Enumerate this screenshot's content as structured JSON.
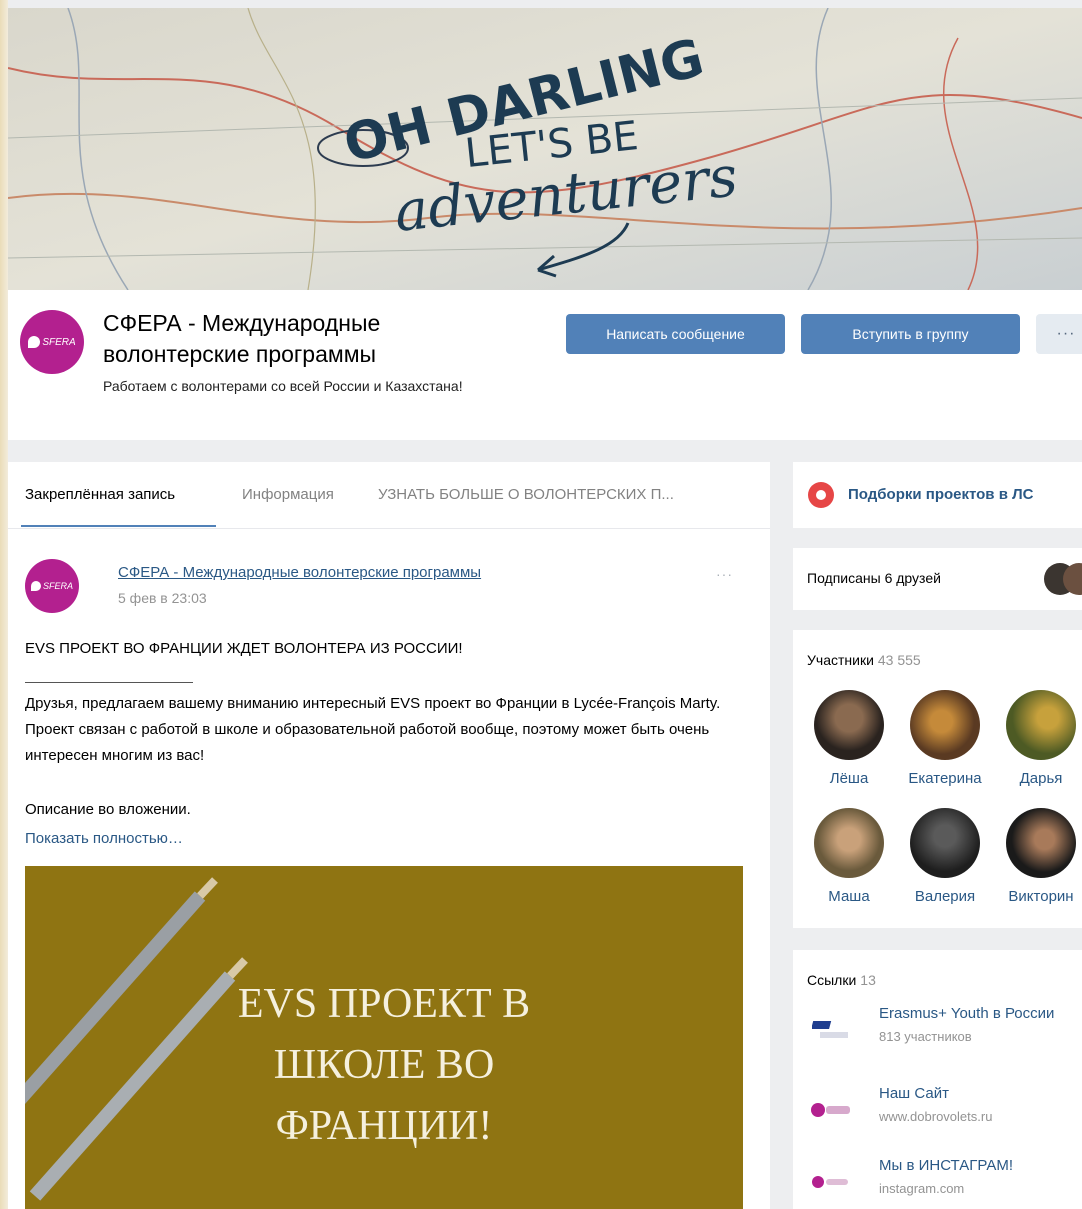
{
  "cover": {
    "line1": "OH DARLING",
    "line2": "LET'S BE",
    "line3": "adventurers"
  },
  "group": {
    "name": "СФЕРА - Международные волонтерские программы",
    "status": "Работаем с волонтерами со всей России и Казахстана!",
    "avatar_text": "SFERA",
    "buttons": {
      "message": "Написать сообщение",
      "join": "Вступить в группу",
      "more": "···"
    }
  },
  "tabs": [
    {
      "label": "Закреплённая запись"
    },
    {
      "label": "Информация"
    },
    {
      "label": "УЗНАТЬ БОЛЬШЕ О ВОЛОНТЕРСКИХ П..."
    }
  ],
  "post": {
    "author": "СФЕРА - Международные волонтерские программы",
    "date": "5 фев в 23:03",
    "menu": "···",
    "headline": "EVS ПРОЕКТ ВО ФРАНЦИИ ЖДЕТ ВОЛОНТЕРА ИЗ РОССИИ!",
    "body": "Друзья, предлагаем вашему вниманию интересный EVS проект во Франции в Lycée-François Marty. Проект связан с работой в школе и образовательной работой вообще, поэтому может быть очень интересен многим из вас!",
    "extra": "Описание во вложении.",
    "show_more": "Показать полностью…",
    "image_text": [
      "EVS ПРОЕКТ В",
      "ШКОЛЕ ВО",
      "ФРАНЦИИ!"
    ]
  },
  "sidebar": {
    "collections": "Подборки проектов в ЛС",
    "friends": "Подписаны 6 друзей",
    "members": {
      "title": "Участники",
      "count": "43 555",
      "list": [
        {
          "name": "Лёша"
        },
        {
          "name": "Екатерина"
        },
        {
          "name": "Дарья"
        },
        {
          "name": "Маша"
        },
        {
          "name": "Валерия"
        },
        {
          "name": "Викторин"
        }
      ]
    },
    "links": {
      "title": "Ссылки",
      "count": "13",
      "list": [
        {
          "title": "Erasmus+ Youth в России",
          "sub": "813 участников",
          "logo": "erasmus-logo"
        },
        {
          "title": "Наш Сайт",
          "sub": "www.dobrovolets.ru",
          "logo": "sfera-logo"
        },
        {
          "title": "Мы в ИНСТАГРАМ!",
          "sub": "instagram.com",
          "logo": "sfera-logo"
        }
      ]
    }
  },
  "colors": {
    "accent": "#5181b8",
    "link": "#2a5885",
    "brand": "#b3208f",
    "post_image_bg": "#8f7412"
  }
}
